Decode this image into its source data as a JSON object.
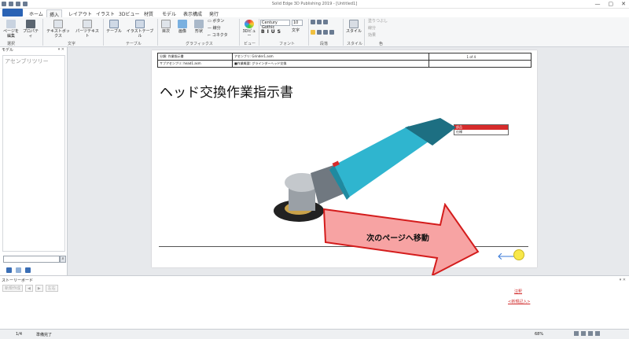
{
  "window": {
    "title": "Solid Edge 3D Publishing 2019 - [Untitled1]",
    "controls": [
      "—",
      "▢",
      "✕"
    ]
  },
  "tabs": [
    "ホーム",
    "挿入",
    "レイアウト",
    "イラスト",
    "3Dビュー",
    "材質",
    "モデル",
    "表示構成",
    "発行"
  ],
  "active_tab": "挿入",
  "ribbon": {
    "edit_page": "ページを\n編集",
    "properties": "プロパティ",
    "textbox": "テキストボックス",
    "parts_text": "パーツテキスト",
    "table": "テーブル",
    "illustration_table": "イラストテーブル",
    "index": "目次",
    "image": "画像",
    "shape": "形状",
    "button": "ボタン",
    "line": "線分",
    "connector": "コネクタ",
    "view3d": "3Dビュー",
    "font_name": "Century Gothic",
    "font_size": "10",
    "text_label": "文字",
    "style": "スタイル",
    "fill_label": "塗りつぶし",
    "border_label": "線分",
    "effect_label": "効果",
    "groups": {
      "select": "選択",
      "text": "文字",
      "table": "テーブル",
      "graphics": "グラフィックス",
      "view": "ビュー",
      "font": "フォント",
      "paragraph": "段落",
      "style": "スタイル",
      "color": "色"
    }
  },
  "left_panel": {
    "header": "モデル",
    "pin": "▾ ✕",
    "root": "アセンブリツリー"
  },
  "document": {
    "header_rows": [
      [
        "分類: 作業指示書",
        "アセンブリ: Grinder1.asm",
        "1 of 4"
      ],
      [
        "サブアセンブリ: head1.asm",
        "■作業概要: グラインダーヘッド交換",
        ""
      ]
    ],
    "title": "ヘッド交換作業指示書",
    "caption_row1": "部品",
    "caption_row2": "仕様",
    "next_arrow": "🡐"
  },
  "callout": {
    "text": "次のページへ移動",
    "fill": "#f7a3a3",
    "border": "#d41c1c"
  },
  "storyboard": {
    "header": "ストーリーボード",
    "pin": "▾ ✕",
    "tools": [
      "新規作成",
      "◀",
      "▶",
      "左右"
    ],
    "notes": "注釈",
    "notes_add": "<新規記入>"
  },
  "status": {
    "page": "1/4",
    "state": "準備完了",
    "zoom": "68%"
  },
  "colors": {
    "accent": "#2a63b5",
    "grinder_body": "#2fb5cf",
    "red": "#d62b2b"
  }
}
